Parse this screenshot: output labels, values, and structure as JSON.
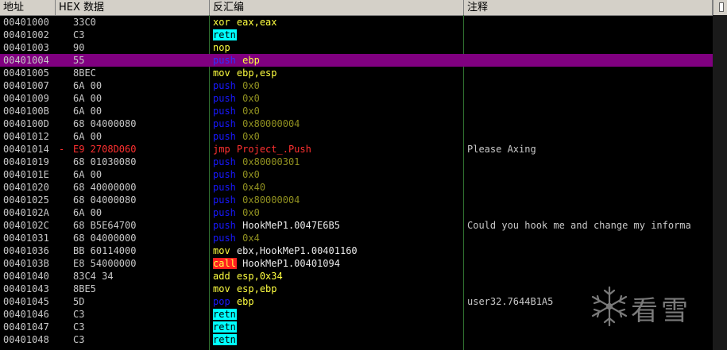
{
  "columns": {
    "address": "地址",
    "hex": "HEX 数据",
    "disasm": "反汇编",
    "comment": "注释"
  },
  "watermark": {
    "icon": "snowflake-icon",
    "text": "看雪"
  },
  "colors": {
    "background": "#000000",
    "selected_row": "#800080",
    "header": "#d4d0c8",
    "retn_highlight": "#00ffff",
    "call_highlight": "#ff2020"
  },
  "rows": [
    {
      "addr": "00401000",
      "mark": "",
      "hex": "33C0",
      "mnemonic": "xor",
      "operand": "eax,eax",
      "cmt": "",
      "kind": "plain",
      "opkind": "reg",
      "selected": false
    },
    {
      "addr": "00401002",
      "mark": "",
      "hex": "C3",
      "mnemonic": "retn",
      "operand": "",
      "cmt": "",
      "kind": "ret",
      "opkind": "reg",
      "selected": false
    },
    {
      "addr": "00401003",
      "mark": "",
      "hex": "90",
      "mnemonic": "nop",
      "operand": "",
      "cmt": "",
      "kind": "plain",
      "opkind": "reg",
      "selected": false
    },
    {
      "addr": "00401004",
      "mark": "",
      "hex": "55",
      "mnemonic": "push",
      "operand": "ebp",
      "cmt": "",
      "kind": "push",
      "opkind": "reg",
      "selected": true
    },
    {
      "addr": "00401005",
      "mark": "",
      "hex": "8BEC",
      "mnemonic": "mov",
      "operand": "ebp,esp",
      "cmt": "",
      "kind": "plain",
      "opkind": "reg",
      "selected": false
    },
    {
      "addr": "00401007",
      "mark": "",
      "hex": "6A 00",
      "mnemonic": "push",
      "operand": "0x0",
      "cmt": "",
      "kind": "push",
      "opkind": "num",
      "selected": false
    },
    {
      "addr": "00401009",
      "mark": "",
      "hex": "6A 00",
      "mnemonic": "push",
      "operand": "0x0",
      "cmt": "",
      "kind": "push",
      "opkind": "num",
      "selected": false
    },
    {
      "addr": "0040100B",
      "mark": "",
      "hex": "6A 00",
      "mnemonic": "push",
      "operand": "0x0",
      "cmt": "",
      "kind": "push",
      "opkind": "num",
      "selected": false
    },
    {
      "addr": "0040100D",
      "mark": "",
      "hex": "68 04000080",
      "mnemonic": "push",
      "operand": "0x80000004",
      "cmt": "",
      "kind": "push",
      "opkind": "num",
      "selected": false
    },
    {
      "addr": "00401012",
      "mark": "",
      "hex": "6A 00",
      "mnemonic": "push",
      "operand": "0x0",
      "cmt": "",
      "kind": "push",
      "opkind": "num",
      "selected": false
    },
    {
      "addr": "00401014",
      "mark": "-",
      "hex": "E9 2708D060",
      "mnemonic": "jmp",
      "operand": "Project_.Push",
      "cmt": "Please Axing",
      "kind": "jmp",
      "opkind": "jmp",
      "selected": false
    },
    {
      "addr": "00401019",
      "mark": "",
      "hex": "68 01030080",
      "mnemonic": "push",
      "operand": "0x80000301",
      "cmt": "",
      "kind": "push",
      "opkind": "num",
      "selected": false
    },
    {
      "addr": "0040101E",
      "mark": "",
      "hex": "6A 00",
      "mnemonic": "push",
      "operand": "0x0",
      "cmt": "",
      "kind": "push",
      "opkind": "num",
      "selected": false
    },
    {
      "addr": "00401020",
      "mark": "",
      "hex": "68 40000000",
      "mnemonic": "push",
      "operand": "0x40",
      "cmt": "",
      "kind": "push",
      "opkind": "num",
      "selected": false
    },
    {
      "addr": "00401025",
      "mark": "",
      "hex": "68 04000080",
      "mnemonic": "push",
      "operand": "0x80000004",
      "cmt": "",
      "kind": "push",
      "opkind": "num",
      "selected": false
    },
    {
      "addr": "0040102A",
      "mark": "",
      "hex": "6A 00",
      "mnemonic": "push",
      "operand": "0x0",
      "cmt": "",
      "kind": "push",
      "opkind": "num",
      "selected": false
    },
    {
      "addr": "0040102C",
      "mark": "",
      "hex": "68 B5E64700",
      "mnemonic": "push",
      "operand": "HookMeP1.0047E6B5",
      "cmt": "Could you hook me and change my informa",
      "kind": "push",
      "opkind": "sym",
      "selected": false
    },
    {
      "addr": "00401031",
      "mark": "",
      "hex": "68 04000000",
      "mnemonic": "push",
      "operand": "0x4",
      "cmt": "",
      "kind": "push",
      "opkind": "num",
      "selected": false
    },
    {
      "addr": "00401036",
      "mark": "",
      "hex": "BB 60114000",
      "mnemonic": "mov",
      "operand": "ebx,HookMeP1.00401160",
      "cmt": "",
      "kind": "plain",
      "opkind": "mixed",
      "selected": false
    },
    {
      "addr": "0040103B",
      "mark": "",
      "hex": "E8 54000000",
      "mnemonic": "call",
      "operand": "HookMeP1.00401094",
      "cmt": "",
      "kind": "call",
      "opkind": "sym",
      "selected": false
    },
    {
      "addr": "00401040",
      "mark": "",
      "hex": "83C4 34",
      "mnemonic": "add",
      "operand": "esp,0x34",
      "cmt": "",
      "kind": "plain",
      "opkind": "reg",
      "selected": false
    },
    {
      "addr": "00401043",
      "mark": "",
      "hex": "8BE5",
      "mnemonic": "mov",
      "operand": "esp,ebp",
      "cmt": "",
      "kind": "plain",
      "opkind": "reg",
      "selected": false
    },
    {
      "addr": "00401045",
      "mark": "",
      "hex": "5D",
      "mnemonic": "pop",
      "operand": "ebp",
      "cmt": "user32.7644B1A5",
      "kind": "push",
      "opkind": "reg",
      "selected": false
    },
    {
      "addr": "00401046",
      "mark": "",
      "hex": "C3",
      "mnemonic": "retn",
      "operand": "",
      "cmt": "",
      "kind": "ret",
      "opkind": "reg",
      "selected": false
    },
    {
      "addr": "00401047",
      "mark": "",
      "hex": "C3",
      "mnemonic": "retn",
      "operand": "",
      "cmt": "",
      "kind": "ret",
      "opkind": "reg",
      "selected": false
    },
    {
      "addr": "00401048",
      "mark": "",
      "hex": "C3",
      "mnemonic": "retn",
      "operand": "",
      "cmt": "",
      "kind": "ret",
      "opkind": "reg",
      "selected": false
    }
  ]
}
